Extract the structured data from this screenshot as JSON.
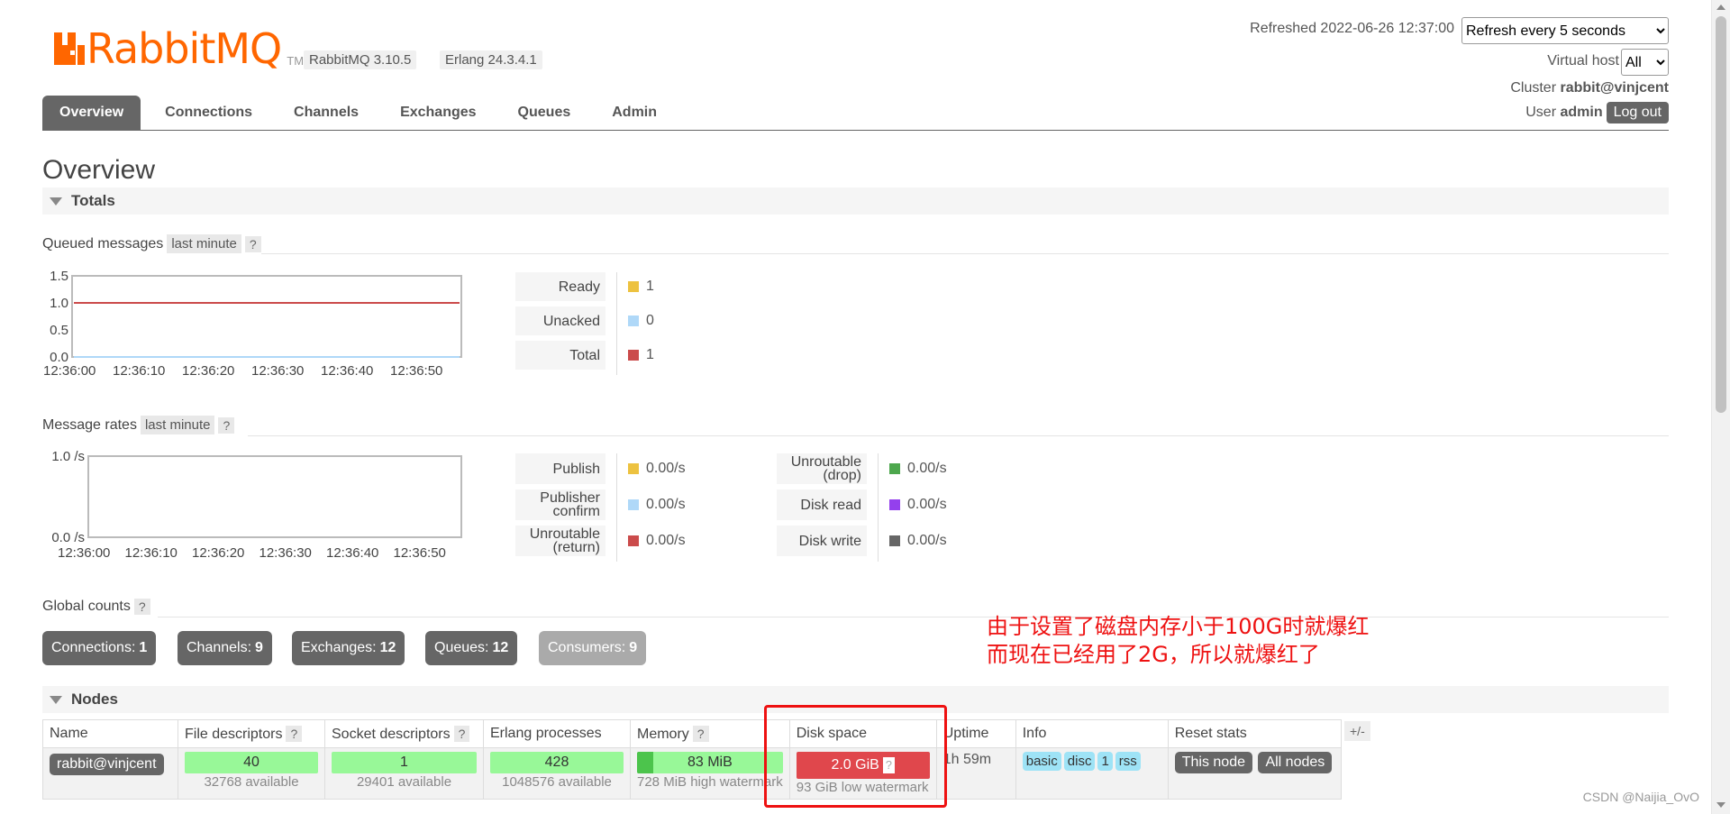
{
  "header": {
    "logo_text": "RabbitMQ",
    "logo_tm": "TM",
    "rabbitmq_version": "RabbitMQ 3.10.5",
    "erlang_version": "Erlang 24.3.4.1",
    "refreshed_label": "Refreshed 2022-06-26 12:37:00",
    "refresh_option": "Refresh every 5 seconds",
    "vhost_label": "Virtual host",
    "vhost_option": "All",
    "cluster_label": "Cluster",
    "cluster_name": "rabbit@vinjcent",
    "user_label": "User",
    "user_name": "admin",
    "logout_label": "Log out"
  },
  "tabs": [
    "Overview",
    "Connections",
    "Channels",
    "Exchanges",
    "Queues",
    "Admin"
  ],
  "page_title": "Overview",
  "totals": {
    "header": "Totals",
    "queued": {
      "label": "Queued messages",
      "range": "last minute",
      "help": "?",
      "legend": [
        {
          "label": "Ready",
          "value": "1",
          "color": "#edc240"
        },
        {
          "label": "Unacked",
          "value": "0",
          "color": "#afd8f8"
        },
        {
          "label": "Total",
          "value": "1",
          "color": "#cb4b4b"
        }
      ]
    },
    "rates": {
      "label": "Message rates",
      "range": "last minute",
      "help": "?",
      "legend_left": [
        {
          "label": "Publish",
          "value": "0.00/s",
          "color": "#edc240"
        },
        {
          "label": "Publisher confirm",
          "value": "0.00/s",
          "color": "#afd8f8"
        },
        {
          "label": "Unroutable (return)",
          "value": "0.00/s",
          "color": "#cb4b4b"
        }
      ],
      "legend_right": [
        {
          "label": "Unroutable (drop)",
          "value": "0.00/s",
          "color": "#4da74d"
        },
        {
          "label": "Disk read",
          "value": "0.00/s",
          "color": "#9440ed"
        },
        {
          "label": "Disk write",
          "value": "0.00/s",
          "color": "#666666"
        }
      ]
    },
    "global_counts": {
      "label": "Global counts",
      "help": "?",
      "items": [
        {
          "label": "Connections:",
          "value": "1"
        },
        {
          "label": "Channels:",
          "value": "9"
        },
        {
          "label": "Exchanges:",
          "value": "12"
        },
        {
          "label": "Queues:",
          "value": "12"
        },
        {
          "label": "Consumers:",
          "value": "9"
        }
      ]
    }
  },
  "chart_data": [
    {
      "type": "line",
      "x": [
        "12:36:00",
        "12:36:10",
        "12:36:20",
        "12:36:30",
        "12:36:40",
        "12:36:50"
      ],
      "y_ticks": [
        "1.5",
        "1.0",
        "0.5",
        "0.0"
      ],
      "ylim": [
        0,
        1.5
      ],
      "series": [
        {
          "name": "Ready",
          "values": [
            1,
            1,
            1,
            1,
            1,
            1
          ],
          "color": "#edc240"
        },
        {
          "name": "Unacked",
          "values": [
            0,
            0,
            0,
            0,
            0,
            0
          ],
          "color": "#afd8f8"
        },
        {
          "name": "Total",
          "values": [
            1,
            1,
            1,
            1,
            1,
            1
          ],
          "color": "#cb4b4b"
        }
      ]
    },
    {
      "type": "line",
      "x": [
        "12:36:00",
        "12:36:10",
        "12:36:20",
        "12:36:30",
        "12:36:40",
        "12:36:50"
      ],
      "y_ticks": [
        "1.0 /s",
        "0.0 /s"
      ],
      "ylim": [
        0,
        1
      ],
      "series": []
    }
  ],
  "annotation": {
    "line1": "由于设置了磁盘内存小于100G时就爆红",
    "line2": "而现在已经用了2G，所以就爆红了"
  },
  "nodes": {
    "header": "Nodes",
    "columns": [
      "Name",
      "File descriptors",
      "Socket descriptors",
      "Erlang processes",
      "Memory",
      "Disk space",
      "Uptime",
      "Info",
      "Reset stats"
    ],
    "plus_minus": "+/-",
    "row": {
      "name": "rabbit@vinjcent",
      "file_descriptors": "40",
      "file_descriptors_sub": "32768 available",
      "socket_descriptors": "1",
      "socket_descriptors_sub": "29401 available",
      "erlang_processes": "428",
      "erlang_processes_sub": "1048576 available",
      "memory": "83 MiB",
      "memory_sub": "728 MiB high watermark",
      "disk_space": "2.0 GiB",
      "disk_space_sub": "93 GiB low watermark",
      "uptime": "1h 59m",
      "info_tags": [
        "basic",
        "disc",
        "1",
        "rss"
      ],
      "reset_this": "This node",
      "reset_all": "All nodes"
    }
  },
  "watermark": "CSDN @Naijia_OvO"
}
